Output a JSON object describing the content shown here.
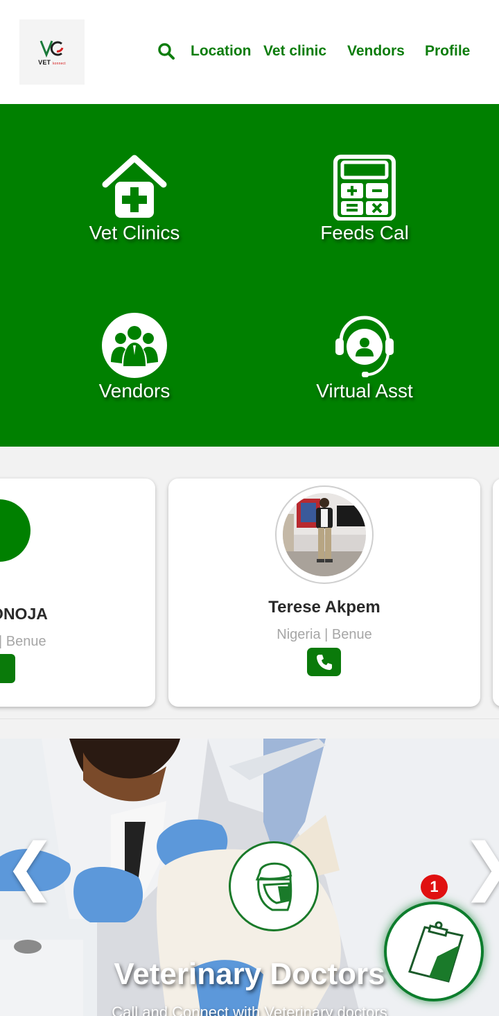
{
  "header": {
    "logo_text": "VET",
    "logo_subtext": "konnect",
    "nav": {
      "location": "Location",
      "vet_clinic": "Vet clinic",
      "vendors": "Vendors",
      "profile": "Profile"
    }
  },
  "features": [
    {
      "label": "Vet Clinics",
      "icon": "clinic-house-icon"
    },
    {
      "label": "Feeds Cal",
      "icon": "calculator-icon"
    },
    {
      "label": "Vendors",
      "icon": "vendors-group-icon"
    },
    {
      "label": "Virtual Asst",
      "icon": "headset-assistant-icon"
    }
  ],
  "vets": [
    {
      "name": "CT ONOJA",
      "location": "| Benue"
    },
    {
      "name": "Terese Akpem",
      "location": "Nigeria | Benue"
    }
  ],
  "hero": {
    "prev": "❮",
    "next": "❯",
    "title": "Veterinary Doctors",
    "subtitle": "Call and Connect with Veterinary doctors"
  },
  "fab": {
    "badge_count": "1",
    "icon": "clipboard-icon"
  },
  "colors": {
    "brand_green": "#008000",
    "nav_green": "#0d7d0d",
    "badge_red": "#e01010"
  }
}
